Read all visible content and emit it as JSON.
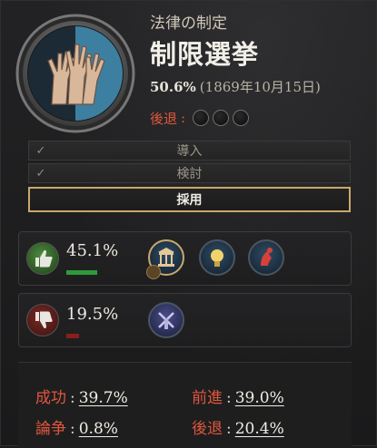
{
  "law": {
    "category": "法律の制定",
    "name": "制限選挙",
    "progress_pct": "50.6%",
    "date": "(1869年10月15日)",
    "regress_label": "後退",
    "regress_colon": ":",
    "regress_slots_filled": 0,
    "regress_slots_total": 3,
    "icon": "raised-hands-icon"
  },
  "stages": [
    {
      "label": "導入",
      "done": true
    },
    {
      "label": "検討",
      "done": true
    },
    {
      "label": "採用",
      "active": true
    }
  ],
  "support": {
    "percent": "45.1%",
    "bar_fraction": 0.45,
    "icon": "thumbs-up-icon",
    "groups": [
      "landowners-icon",
      "industrialists-icon",
      "intelligentsia-icon"
    ]
  },
  "oppose": {
    "percent": "19.5%",
    "bar_fraction": 0.12,
    "icon": "thumbs-down-icon",
    "groups": [
      "rural-folk-icon"
    ]
  },
  "odds": {
    "success_label": "成功",
    "success_value": "39.7%",
    "advance_label": "前進",
    "advance_value": "39.0%",
    "debate_label": "論争",
    "debate_value": "0.8%",
    "regress_label": "後退",
    "regress_value": "20.4%",
    "colon": ":"
  },
  "colors": {
    "accent_gold": "#c8a96b",
    "negative_red": "#e0573d",
    "support_green": "#2f9a3a",
    "oppose_red": "#8a1f1a"
  }
}
